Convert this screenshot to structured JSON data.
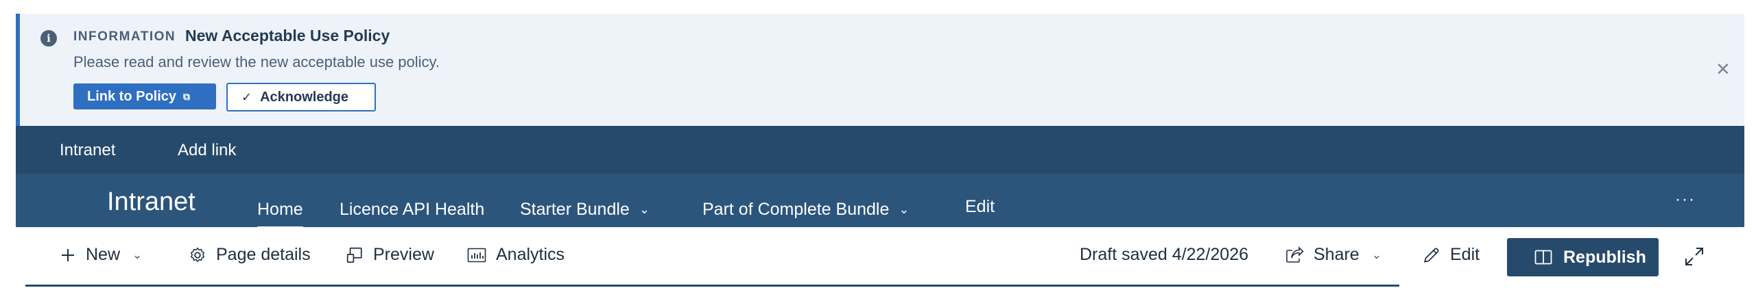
{
  "banner": {
    "tag": "INFORMATION",
    "title": "New Acceptable Use Policy",
    "description": "Please read and review the new acceptable use policy.",
    "link_label": "Link to Policy",
    "ack_label": "Acknowledge"
  },
  "hubnav": {
    "site_name": "Intranet",
    "add_link": "Add link"
  },
  "site": {
    "name": "Intranet",
    "nav": [
      {
        "label": "Home",
        "active": true
      },
      {
        "label": "Licence API Health"
      },
      {
        "label": "Starter Bundle",
        "dropdown": true
      },
      {
        "label": "Part of Complete Bundle",
        "dropdown": true
      },
      {
        "label": "Edit"
      }
    ]
  },
  "commandbar": {
    "new_label": "New",
    "page_details_label": "Page details",
    "preview_label": "Preview",
    "analytics_label": "Analytics",
    "draft_status": "Draft saved 4/22/2026",
    "share_label": "Share",
    "edit_label": "Edit",
    "republish_label": "Republish"
  },
  "colors": {
    "accent": "#2f6fc1",
    "hub_bg": "#264a6b",
    "site_bg": "#2c557c",
    "banner_bg": "#eef3fa"
  }
}
